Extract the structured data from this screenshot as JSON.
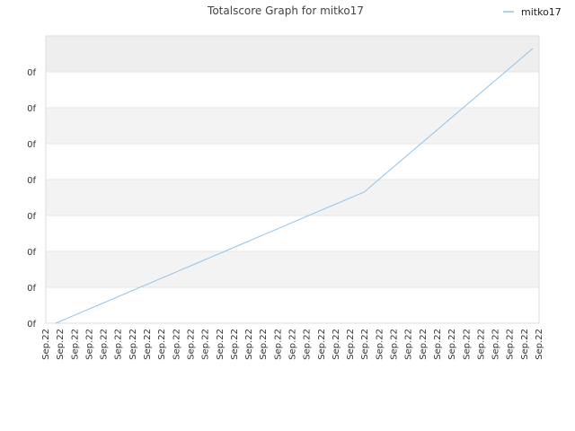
{
  "chart_data": {
    "type": "line",
    "title": "Totalscore Graph for mitko17",
    "xlabel": "",
    "ylabel": "",
    "x": [
      "Sep.22",
      "Sep.22",
      "Sep.22",
      "Sep.22",
      "Sep.22",
      "Sep.22",
      "Sep.22",
      "Sep.22",
      "Sep.22",
      "Sep.22",
      "Sep.22",
      "Sep.22",
      "Sep.22",
      "Sep.22",
      "Sep.22",
      "Sep.22",
      "Sep.22",
      "Sep.22",
      "Sep.22",
      "Sep.22",
      "Sep.22",
      "Sep.22",
      "Sep.22",
      "Sep.22",
      "Sep.22",
      "Sep.22",
      "Sep.22",
      "Sep.22",
      "Sep.22",
      "Sep.22",
      "Sep.22",
      "Sep.22",
      "Sep.22",
      "Sep.22",
      "Sep.22"
    ],
    "y_tick_labels": [
      "0f",
      "0f",
      "0f",
      "0f",
      "0f",
      "0f",
      "0f",
      "0f"
    ],
    "series": [
      {
        "name": "mitko17",
        "color": "#8fc3ec",
        "values": [
          0.0,
          0.5,
          1.0,
          1.5,
          2.0,
          2.5,
          3.0,
          3.5,
          4.0,
          4.5,
          5.0,
          5.5,
          6.0,
          6.5,
          7.0,
          7.5,
          8.0,
          8.5,
          9.0,
          9.5,
          10.0,
          10.5,
          11.0,
          12.0,
          13.0,
          14.0,
          15.0,
          16.0,
          17.0,
          18.0,
          19.0,
          20.0,
          21.0,
          22.0,
          23.0
        ]
      }
    ],
    "legend": "top-right",
    "grid": true
  }
}
